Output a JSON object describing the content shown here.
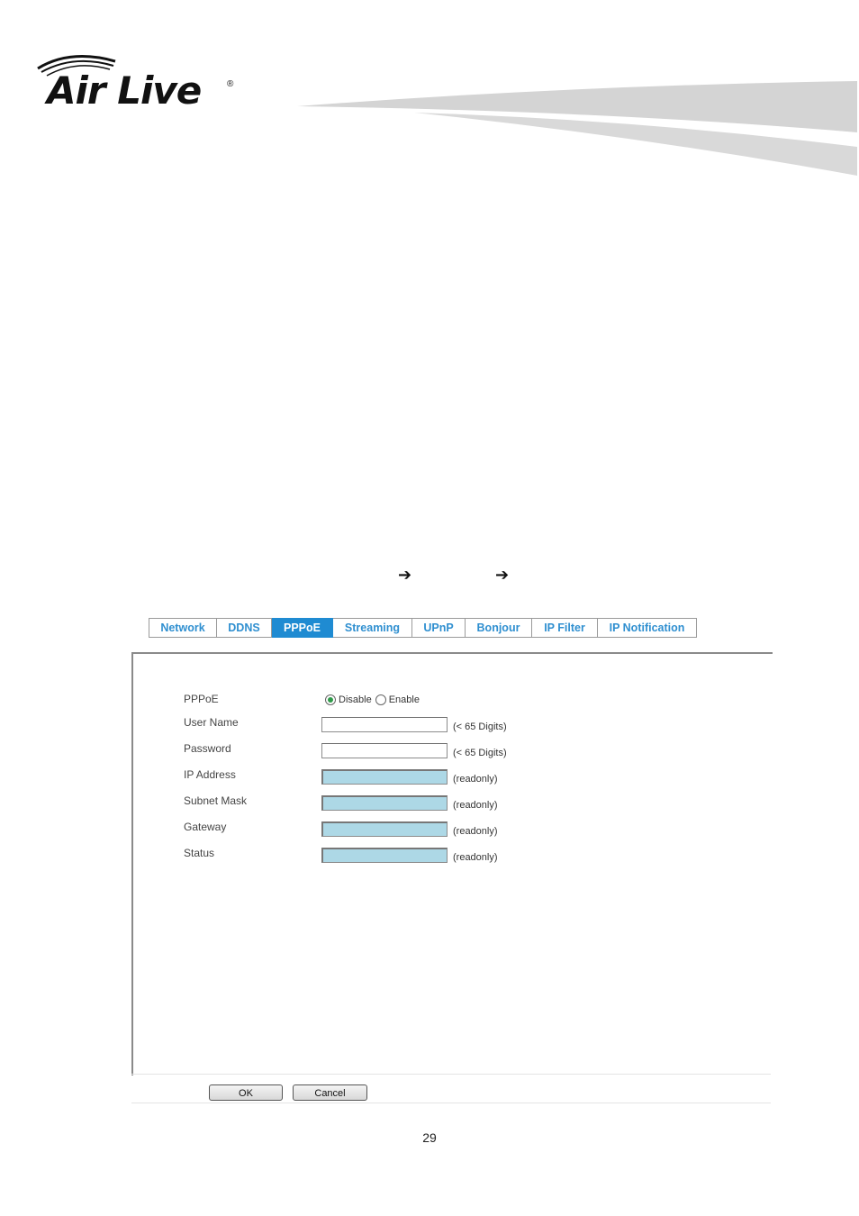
{
  "brand": {
    "logo_text": "Air Live",
    "registered_mark": "®"
  },
  "breadcrumb_arrows": [
    "➔",
    "➔"
  ],
  "tabs": [
    {
      "label": "Network"
    },
    {
      "label": "DDNS"
    },
    {
      "label": "PPPoE",
      "active": true
    },
    {
      "label": "Streaming"
    },
    {
      "label": "UPnP"
    },
    {
      "label": "Bonjour"
    },
    {
      "label": "IP Filter"
    },
    {
      "label": "IP Notification"
    }
  ],
  "form": {
    "pppoe": {
      "label": "PPPoE",
      "options": [
        "Disable",
        "Enable"
      ],
      "selected": "Disable"
    },
    "user_name": {
      "label": "User Name",
      "value": "",
      "hint": "(< 65 Digits)"
    },
    "password": {
      "label": "Password",
      "value": "",
      "hint": "(< 65 Digits)"
    },
    "ip_address": {
      "label": "IP Address",
      "value": "",
      "hint": "(readonly)"
    },
    "subnet_mask": {
      "label": "Subnet Mask",
      "value": "",
      "hint": "(readonly)"
    },
    "gateway": {
      "label": "Gateway",
      "value": "",
      "hint": "(readonly)"
    },
    "status": {
      "label": "Status",
      "value": "",
      "hint": "(readonly)"
    }
  },
  "buttons": {
    "ok": "OK",
    "cancel": "Cancel"
  },
  "page_number": "29",
  "colors": {
    "tab_active_bg": "#1f8bd2",
    "tab_text": "#2f8fd0",
    "readonly_bg": "#add8e6"
  }
}
